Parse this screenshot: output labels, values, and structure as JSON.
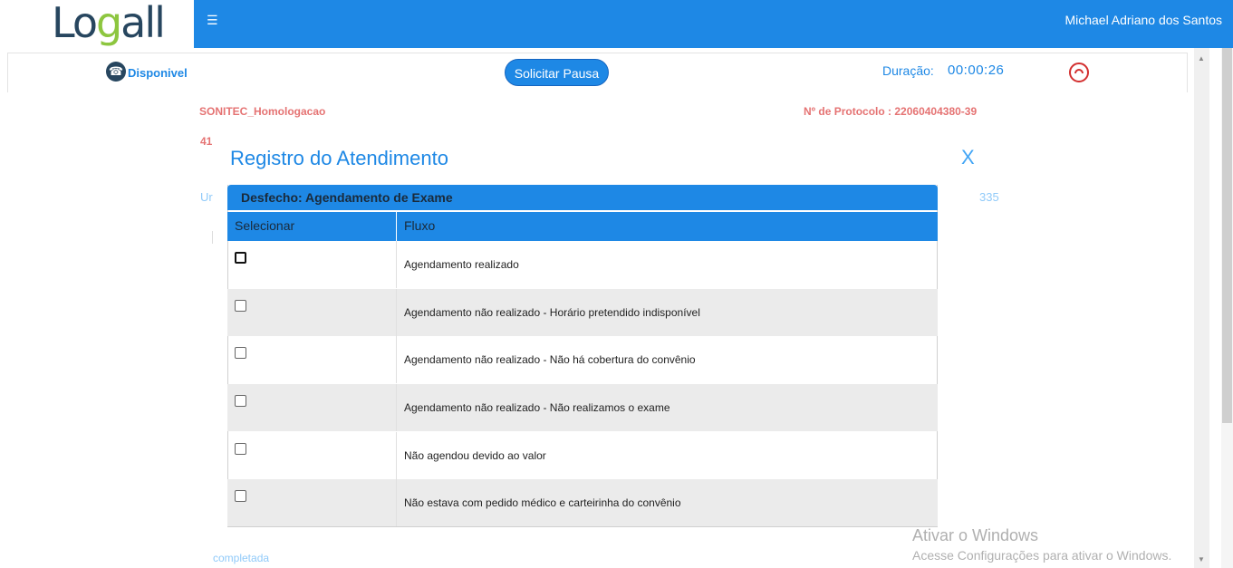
{
  "header": {
    "logo_text": "Logall",
    "user_name": "Michael Adriano dos Santos"
  },
  "status": {
    "availability": "Disponivel",
    "pause_button": "Solicitar Pausa",
    "duration_label": "Duração:",
    "duration_value": "00:00:26"
  },
  "background": {
    "company": "SONITEC_Homologacao",
    "protocol": "Nº de Protocolo : 22060404380-39",
    "fragment_41": "41",
    "fragment_ur": "Ur",
    "fragment_35": "335",
    "fragment_completada": "completada"
  },
  "modal": {
    "title": "Registro do Atendimento",
    "close_label": "X",
    "panel_title": "Desfecho: Agendamento de Exame",
    "columns": [
      "Selecionar",
      "Fluxo"
    ],
    "rows": [
      {
        "label": "Agendamento realizado"
      },
      {
        "label": "Agendamento não realizado - Horário pretendido indisponível"
      },
      {
        "label": "Agendamento não realizado - Não há cobertura do convênio"
      },
      {
        "label": "Agendamento não realizado - Não realizamos o exame"
      },
      {
        "label": "Não agendou devido ao valor"
      },
      {
        "label": "Não estava com pedido médico e carteirinha do convênio"
      }
    ]
  },
  "watermark": {
    "line1": "Ativar o Windows",
    "line2": "Acesse Configurações para ativar o Windows."
  },
  "icons": {
    "menu": "hamburger-icon",
    "phone": "phone-icon",
    "hangup": "hangup-icon"
  },
  "colors": {
    "brand_blue": "#1e88e5",
    "alert_red": "#e57373"
  }
}
